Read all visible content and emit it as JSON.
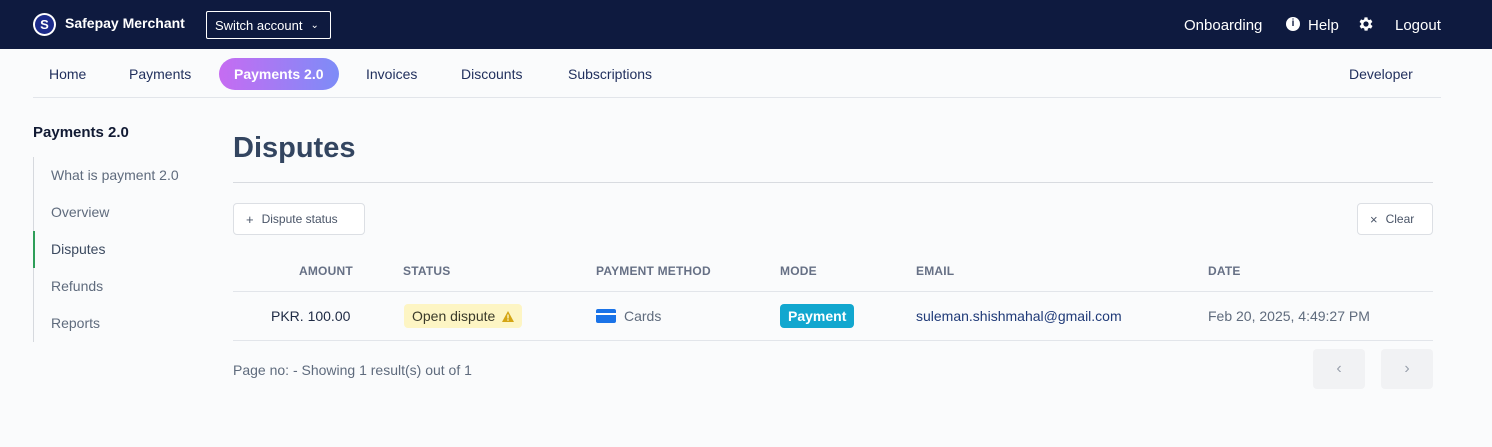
{
  "header": {
    "brand": "Safepay Merchant",
    "logo_letter": "S",
    "switch_label": "Switch account",
    "links": {
      "onboarding": "Onboarding",
      "help": "Help",
      "logout": "Logout"
    }
  },
  "nav": {
    "items": [
      "Home",
      "Payments",
      "Payments 2.0",
      "Invoices",
      "Discounts",
      "Subscriptions"
    ],
    "active": "Payments 2.0",
    "developer": "Developer"
  },
  "sidebar": {
    "title": "Payments 2.0",
    "items": [
      "What is payment 2.0",
      "Overview",
      "Disputes",
      "Refunds",
      "Reports"
    ],
    "active": "Disputes"
  },
  "main": {
    "title": "Disputes",
    "filter_label": "Dispute status",
    "clear_label": "Clear",
    "columns": [
      "AMOUNT",
      "STATUS",
      "PAYMENT METHOD",
      "MODE",
      "EMAIL",
      "DATE"
    ],
    "rows": [
      {
        "amount": "PKR. 100.00",
        "status": "Open dispute",
        "payment_method": "Cards",
        "mode": "Payment",
        "email": "suleman.shishmahal@gmail.com",
        "date": "Feb 20, 2025, 4:49:27 PM"
      }
    ],
    "pager_text": "Page no: - Showing 1 result(s) out of 1"
  },
  "colors": {
    "topbar": "#0e1a3f",
    "active_tab_gradient": [
      "#c66cf2",
      "#7d8cf7"
    ],
    "status_badge_bg": "#fdf5c4",
    "mode_badge_bg": "#12a7cf",
    "sidebar_active_marker": "#2e9e59"
  },
  "icons": [
    "logo-icon",
    "chevron-down-icon",
    "info-icon",
    "gear-icon",
    "plus-icon",
    "close-icon",
    "warning-icon",
    "credit-card-icon",
    "chevron-left-icon",
    "chevron-right-icon"
  ]
}
